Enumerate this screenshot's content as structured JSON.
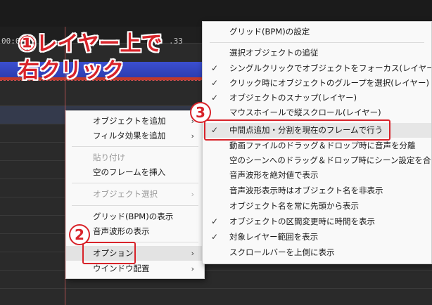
{
  "timeline": {
    "time_start": "00:0",
    "time_mid": ".33"
  },
  "annotations": {
    "step1_line1": "①レイヤー上で",
    "step1_line2": "右クリック",
    "step2": "2",
    "step3": "3"
  },
  "context_menu": {
    "items": [
      {
        "label": "オブジェクトを追加",
        "arrow": "›",
        "disabled": false
      },
      {
        "label": "フィルタ効果を追加",
        "arrow": "›",
        "disabled": false
      },
      {
        "label": "貼り付け",
        "arrow": "",
        "disabled": true
      },
      {
        "label": "空のフレームを挿入",
        "arrow": "",
        "disabled": false
      },
      {
        "label": "オブジェクト選択",
        "arrow": "›",
        "disabled": true
      },
      {
        "label": "グリッド(BPM)の表示",
        "arrow": "",
        "disabled": false
      },
      {
        "label": "音声波形の表示",
        "arrow": "",
        "disabled": false
      },
      {
        "label": "オプション",
        "arrow": "›",
        "disabled": false
      },
      {
        "label": "ウインドウ配置",
        "arrow": "›",
        "disabled": false
      }
    ]
  },
  "options_submenu": {
    "items": [
      {
        "label": "グリッド(BPM)の設定",
        "checked": false
      },
      {
        "label": "選択オブジェクトの追従",
        "checked": false
      },
      {
        "label": "シングルクリックでオブジェクトをフォーカス(レイヤー)",
        "checked": true
      },
      {
        "label": "クリック時にオブジェクトのグループを選択(レイヤー)",
        "checked": true
      },
      {
        "label": "オブジェクトのスナップ(レイヤー)",
        "checked": true
      },
      {
        "label": "マウスホイールで縦スクロール(レイヤー)",
        "checked": false
      },
      {
        "label": "中間点追加・分割を現在のフレームで行う",
        "checked": true
      },
      {
        "label": "動画ファイルのドラッグ＆ドロップ時に音声を分離",
        "checked": false
      },
      {
        "label": "空のシーンへのドラッグ＆ドロップ時にシーン設定を合わせる",
        "checked": false
      },
      {
        "label": "音声波形を絶対値で表示",
        "checked": false
      },
      {
        "label": "音声波形表示時はオブジェクト名を非表示",
        "checked": false
      },
      {
        "label": "オブジェクト名を常に先頭から表示",
        "checked": false
      },
      {
        "label": "オブジェクトの区間変更時に時間を表示",
        "checked": true
      },
      {
        "label": "対象レイヤー範囲を表示",
        "checked": true
      },
      {
        "label": "スクロールバーを上側に表示",
        "checked": false
      }
    ]
  },
  "colors": {
    "annotation_red": "#d8232a",
    "layer_blue": "#3b4fd0"
  }
}
